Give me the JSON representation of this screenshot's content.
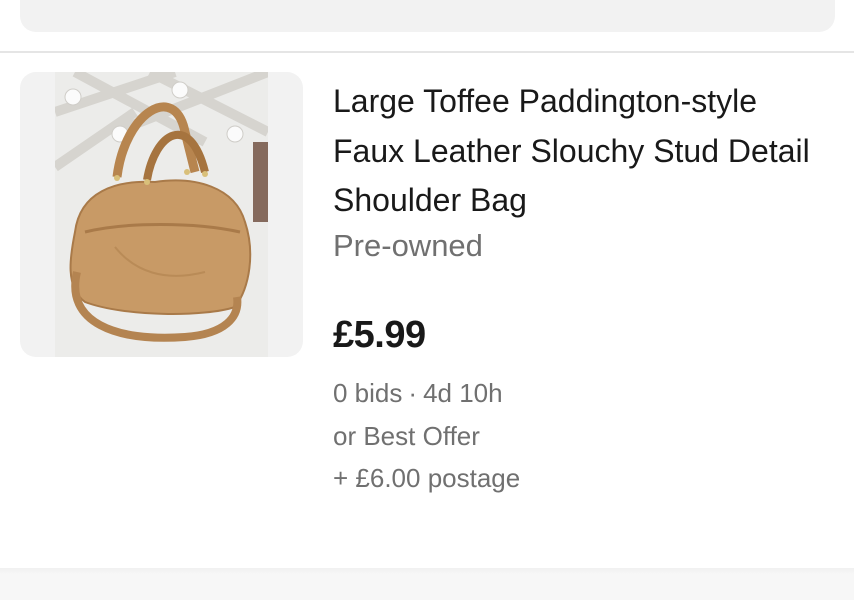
{
  "listing": {
    "title": "Large Toffee Paddington-style Faux Leather Slouchy Stud Detail Shoulder Bag",
    "condition": "Pre-owned",
    "price": "£5.99",
    "bids": "0 bids",
    "separator": "·",
    "time_left": "4d 10h",
    "best_offer": "or Best Offer",
    "postage": "+ £6.00 postage"
  }
}
